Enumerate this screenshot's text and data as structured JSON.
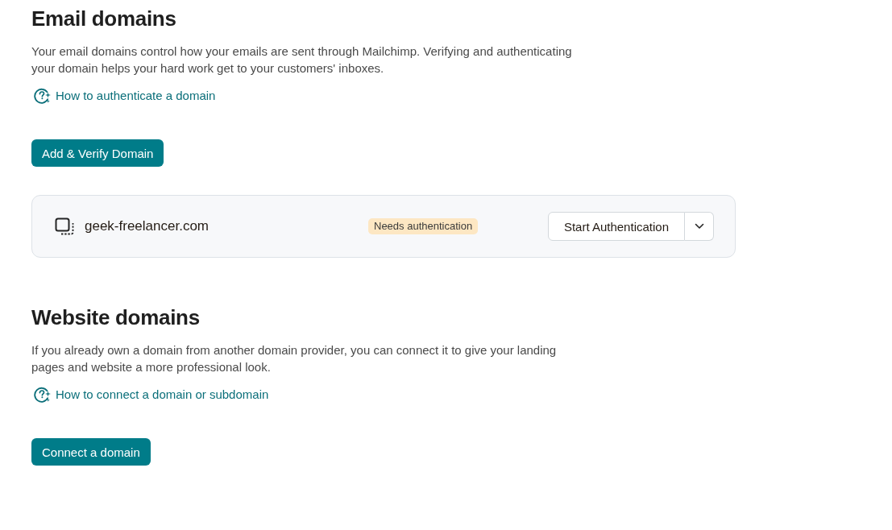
{
  "sections": [
    {
      "title": "Email domains",
      "description": "Your email domains control how your emails are sent through Mailchimp. Verifying and authenticating your domain helps your hard work get to your customers' inboxes.",
      "help_link": "How to authenticate a domain",
      "primary_button": "Add & Verify Domain",
      "domains": [
        {
          "name": "geek-freelancer.com",
          "status": "Needs authentication",
          "action": "Start Authentication"
        }
      ]
    },
    {
      "title": "Website domains",
      "description": "If you already own a domain from another domain provider, you can connect it to give your landing pages and website a more professional look.",
      "help_link": "How to connect a domain or subdomain",
      "primary_button": "Connect a domain"
    }
  ]
}
